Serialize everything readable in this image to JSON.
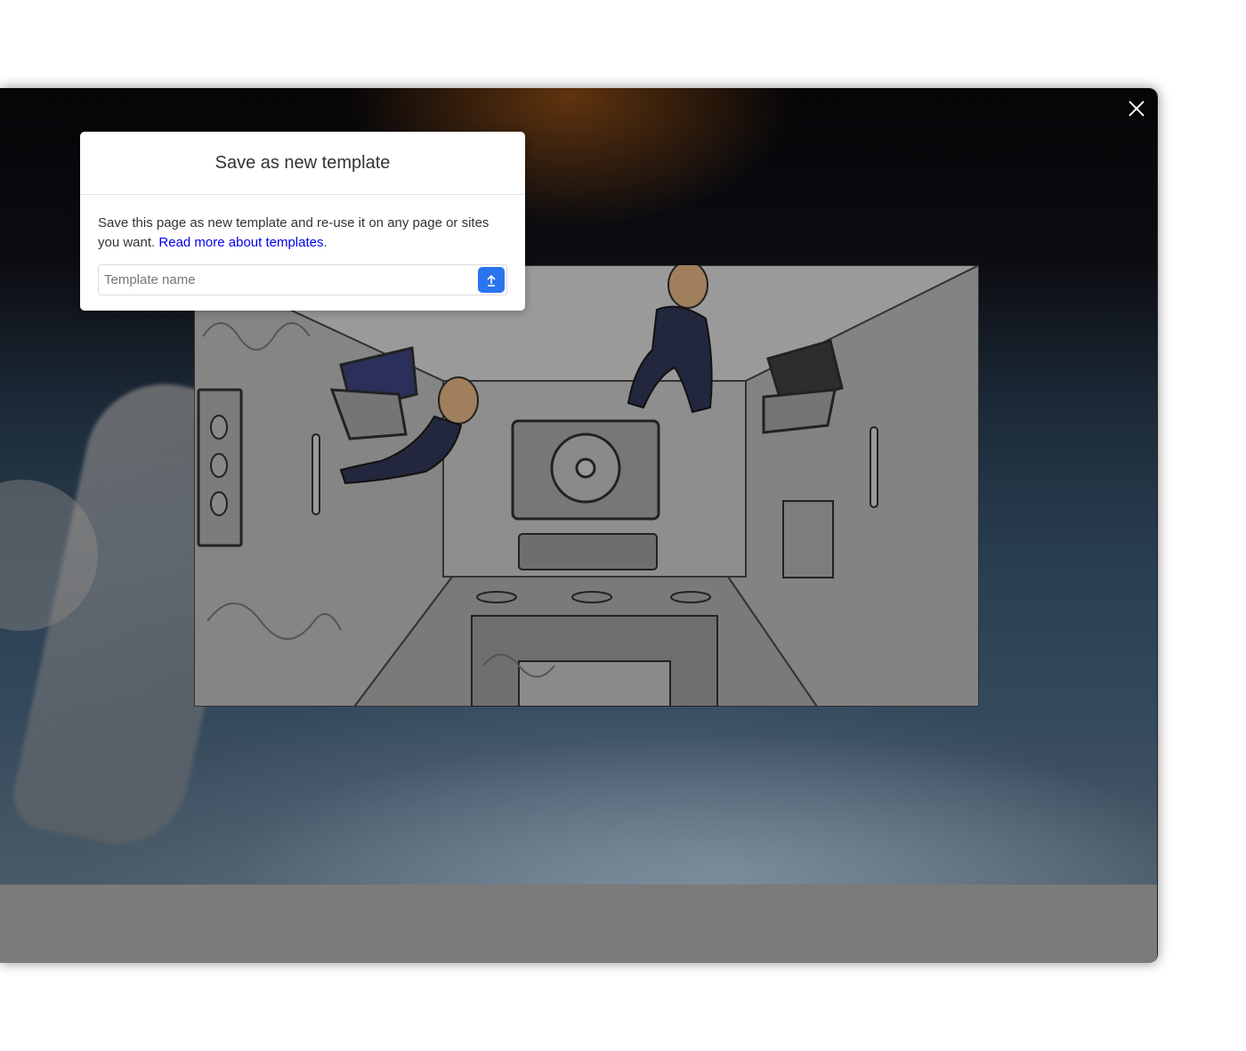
{
  "popover": {
    "title": "Save as new template",
    "description": "Save this page as new template and re-use it on any page or sites you want.",
    "read_more_link": "Read more about templates",
    "period": ".",
    "input_placeholder": "Template name",
    "submit_icon": "upload-icon"
  },
  "window": {
    "close_icon": "close-icon"
  },
  "colors": {
    "accent": "#2a74ee",
    "link": "#0000ee",
    "footer": "#7b7b7b"
  }
}
